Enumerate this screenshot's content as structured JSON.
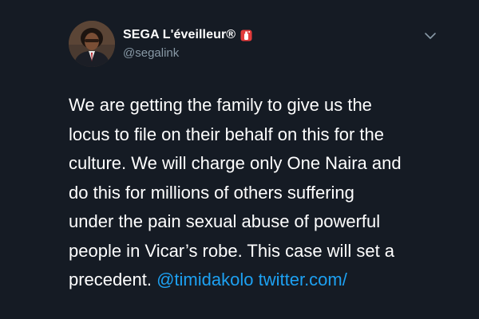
{
  "author": {
    "display_name": "SEGA L'éveilleur®",
    "handle": "@segalink",
    "avatar_icon": "profile-photo",
    "badge_icon": "fire-extinguisher-emoji"
  },
  "menu_icon": "chevron-down-icon",
  "tweet": {
    "lines": [
      "We are getting the family to give us the",
      "locus to file on their behalf on this for the",
      "culture. We will charge only One Naira and",
      "do this for millions of others suffering",
      "under the pain sexual abuse of powerful",
      "people in Vicar’s robe. This case will set a"
    ],
    "last_line_text": "precedent.",
    "mention": "@timidakolo",
    "url": "twitter.com/"
  },
  "colors": {
    "background": "#151b24",
    "text": "#ffffff",
    "secondary_text": "#8899a6",
    "link": "#1da1f2"
  }
}
